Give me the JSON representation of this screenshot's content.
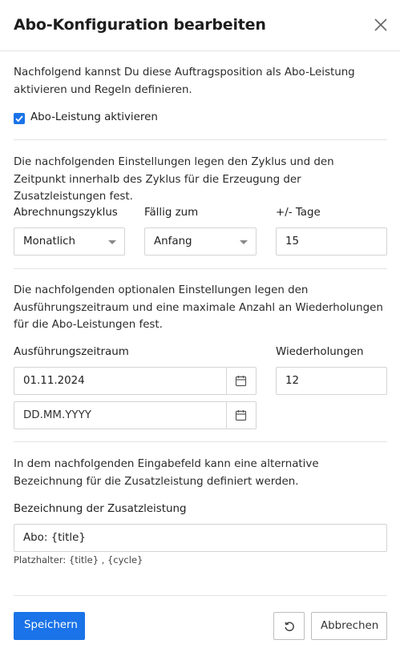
{
  "dialog": {
    "title": "Abo-Konfiguration bearbeiten",
    "close_icon": "close-icon"
  },
  "intro": {
    "text": "Nachfolgend kannst Du diese Auftragsposition als Abo-Leistung aktivieren und Regeln definieren.",
    "checkbox_label": "Abo-Leistung aktivieren",
    "checkbox_checked": true
  },
  "cycle_section": {
    "text": "Die nachfolgenden Einstellungen legen den Zyklus und den Zeitpunkt innerhalb des Zyklus für die Erzeugung der Zusatzleistungen fest.",
    "billing_cycle_label": "Abrechnungszyklus",
    "billing_cycle_value": "Monatlich",
    "due_label": "Fällig zum",
    "due_value": "Anfang",
    "days_label": "+/- Tage",
    "days_value": "15"
  },
  "period_section": {
    "text": "Die nachfolgenden optionalen Einstellungen legen den Ausführungszeitraum und eine maximale Anzahl an Wiederholungen für die Abo-Leistungen fest.",
    "period_label": "Ausführungszeitraum",
    "start_date_value": "01.11.2024",
    "end_date_placeholder": "DD.MM.YYYY",
    "repetitions_label": "Wiederholungen",
    "repetitions_value": "12"
  },
  "name_section": {
    "text": "In dem nachfolgenden Eingabefeld kann eine alternative Bezeichnung für die Zusatzleistung definiert werden.",
    "name_label": "Bezeichnung der Zusatzleistung",
    "name_value": "Abo: {title}",
    "hint": "Platzhalter: {title} , {cycle}"
  },
  "footer": {
    "save_label": "Speichern",
    "cancel_label": "Abbrechen",
    "reset_icon": "reset-icon"
  },
  "colors": {
    "accent": "#1a73e8",
    "border": "#d4d4d4",
    "divider": "#e3e3e3"
  }
}
